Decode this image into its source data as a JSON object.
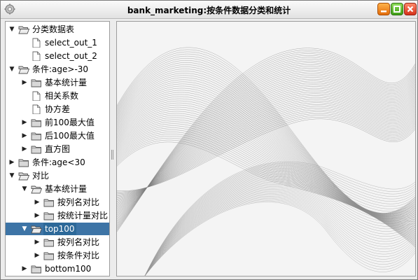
{
  "window": {
    "title": "bank_marketing:按条件数据分类和统计",
    "icon": "gear-icon",
    "buttons": [
      "minimize",
      "maximize",
      "close"
    ]
  },
  "tree": {
    "nodes": [
      {
        "label": "分类数据表",
        "type": "folder",
        "state": "expanded",
        "depth": 0
      },
      {
        "label": "select_out_1",
        "type": "file",
        "state": "leaf",
        "depth": 1
      },
      {
        "label": "select_out_2",
        "type": "file",
        "state": "leaf",
        "depth": 1
      },
      {
        "label": "条件:age>-30",
        "type": "folder",
        "state": "expanded",
        "depth": 0
      },
      {
        "label": "基本统计量",
        "type": "folder",
        "state": "collapsed",
        "depth": 1
      },
      {
        "label": "相关系数",
        "type": "file",
        "state": "leaf",
        "depth": 1
      },
      {
        "label": "协方差",
        "type": "file",
        "state": "leaf",
        "depth": 1
      },
      {
        "label": "前100最大值",
        "type": "folder",
        "state": "collapsed",
        "depth": 1
      },
      {
        "label": "后100最大值",
        "type": "folder",
        "state": "collapsed",
        "depth": 1
      },
      {
        "label": "直方图",
        "type": "folder",
        "state": "collapsed",
        "depth": 1
      },
      {
        "label": "条件:age<30",
        "type": "folder",
        "state": "collapsed",
        "depth": 0
      },
      {
        "label": "对比",
        "type": "folder",
        "state": "expanded",
        "depth": 0
      },
      {
        "label": "基本统计量",
        "type": "folder",
        "state": "expanded",
        "depth": 1
      },
      {
        "label": "按列名对比",
        "type": "folder",
        "state": "collapsed",
        "depth": 2
      },
      {
        "label": "按统计量对比",
        "type": "folder",
        "state": "collapsed",
        "depth": 2
      },
      {
        "label": "top100",
        "type": "folder",
        "state": "expanded",
        "depth": 1,
        "selected": true
      },
      {
        "label": "按列名对比",
        "type": "folder",
        "state": "collapsed",
        "depth": 2
      },
      {
        "label": "按条件对比",
        "type": "folder",
        "state": "collapsed",
        "depth": 2
      },
      {
        "label": "bottom100",
        "type": "folder",
        "state": "collapsed",
        "depth": 1
      }
    ]
  },
  "colors": {
    "selection": "#2d6999",
    "wave": "#8a8a8a"
  }
}
